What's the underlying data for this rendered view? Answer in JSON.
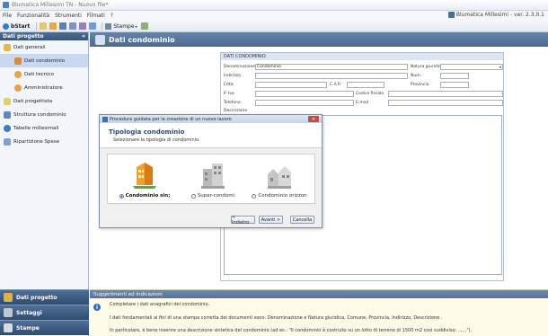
{
  "window": {
    "title": "Blumatica Millesimi TN - Nuovo file*"
  },
  "menu": {
    "items": [
      "File",
      "Funzionalità",
      "Strumenti",
      "Filmati",
      "?"
    ],
    "version": "Blumatica Millesimi - ver. 2.3.0.1"
  },
  "toolbar": {
    "start_label": "bStart",
    "stampe_label": "Stampe"
  },
  "sidebar": {
    "header": "Dati progetto",
    "collapse_glyph": "«",
    "items": [
      {
        "label": "Dati generali",
        "icon": "folder-icon"
      },
      {
        "label": "Dati condominio",
        "icon": "building-icon"
      },
      {
        "label": "Dati tecnico",
        "icon": "person-icon"
      },
      {
        "label": "Amministratore",
        "icon": "person-icon"
      },
      {
        "label": "Dati progettista",
        "icon": "pencil-icon"
      },
      {
        "label": "Struttura condominio",
        "icon": "structure-icon"
      },
      {
        "label": "Tabelle millesimali",
        "icon": "table-icon"
      },
      {
        "label": "Ripartizione Spese",
        "icon": "coins-icon"
      }
    ],
    "bottom": [
      {
        "label": "Dati progetto",
        "icon": "building-icon"
      },
      {
        "label": "Settaggi",
        "icon": "settings-icon"
      },
      {
        "label": "Stampe",
        "icon": "printer-icon"
      }
    ]
  },
  "main": {
    "title": "Dati condominio"
  },
  "form": {
    "section_title": "DATI CONDOMINIO",
    "labels": {
      "denominazione": "Denominazione",
      "natura": "Natura giuridica",
      "indirizzo": "Indirizzo",
      "num": "Num.",
      "citta": "Città",
      "cap": "C.A.P.",
      "provincia": "Provincia",
      "piva": "P. Iva",
      "codfisc": "Codice fiscale",
      "telefono": "Telefono",
      "email": "E-mail",
      "descrizione": "Descrizione"
    },
    "values": {
      "denominazione": "Condominio"
    }
  },
  "dialog": {
    "title": "Procedura guidata per la creazione di un nuovo lavoro",
    "heading": "Tipologia condominio",
    "subheading": "Selezionare la tipologia di condominio.",
    "options": [
      {
        "label": "Condominio sin;",
        "selected": true
      },
      {
        "label": "Super-condomi",
        "selected": false
      },
      {
        "label": "Condominio orizzon",
        "selected": false
      }
    ],
    "buttons": {
      "back": "< Indietro",
      "next": "Avanti >",
      "cancel": "Cancella"
    }
  },
  "hints": {
    "header": "Suggerimenti ed Indicazioni",
    "line1": "Completare i dati anagrafici del condominio.",
    "line2": "I dati fondamentali ai fini di una stampa corretta dei documenti sono: Denominazione e Natura giuridica, Comune, Provincia, Indirizzo, Descrizione .",
    "line3": "In particolare, è bene inserire una descrizione sintetica del condominio (ad es.: \"Il condominio è costruito su un lotto di terreno di 1500 m2 così suddiviso: ......\")."
  }
}
